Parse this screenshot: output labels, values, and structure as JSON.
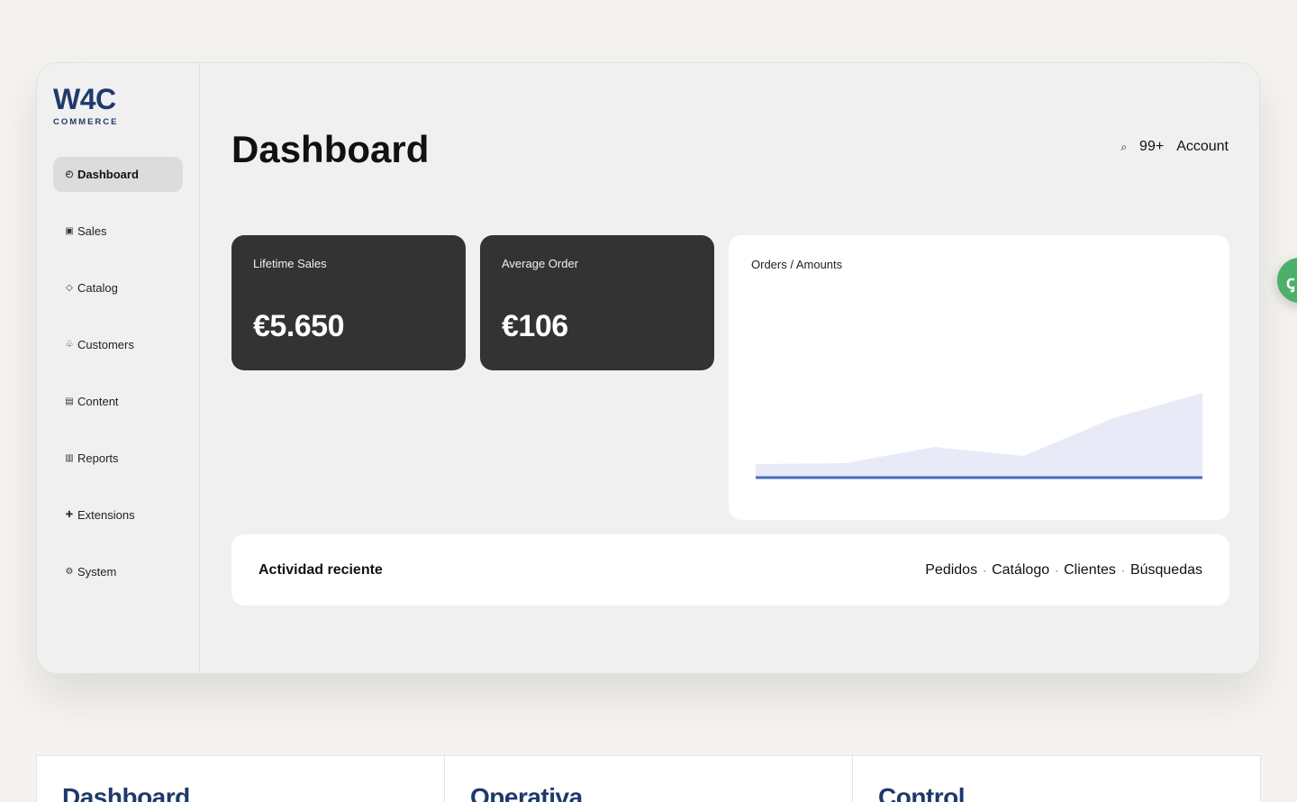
{
  "brand": {
    "name": "W4C",
    "tagline": "COMMERCE"
  },
  "sidebar": {
    "items": [
      {
        "icon": "◴",
        "icon_name": "dashboard-icon",
        "label": "Dashboard",
        "active": true
      },
      {
        "icon": "▣",
        "icon_name": "sales-icon",
        "label": "Sales"
      },
      {
        "icon": "◇",
        "icon_name": "catalog-icon",
        "label": "Catalog"
      },
      {
        "icon": "♧",
        "icon_name": "customers-icon",
        "label": "Customers"
      },
      {
        "icon": "▤",
        "icon_name": "content-icon",
        "label": "Content"
      },
      {
        "icon": "▥",
        "icon_name": "reports-icon",
        "label": "Reports"
      },
      {
        "icon": "✚",
        "icon_name": "extensions-icon",
        "label": "Extensions"
      },
      {
        "icon": "⚙",
        "icon_name": "system-icon",
        "label": "System"
      }
    ]
  },
  "header": {
    "title": "Dashboard",
    "search_icon": "⌕",
    "notifications": "99+",
    "account": "Account"
  },
  "cards": [
    {
      "label": "Lifetime Sales",
      "value": "€5.650"
    },
    {
      "label": "Average Order",
      "value": "€106"
    }
  ],
  "chart": {
    "title": "Orders / Amounts",
    "colors": {
      "area": "#e8eaf8",
      "line": "#4a6bc4"
    }
  },
  "chart_data": {
    "type": "area",
    "title": "Orders / Amounts",
    "x": [
      0,
      1,
      2,
      3,
      4,
      5,
      6
    ],
    "series": [
      {
        "values": [
          15,
          16,
          34,
          24,
          66,
          94
        ]
      },
      {
        "values": [
          0,
          0,
          0,
          0,
          0,
          0
        ]
      }
    ],
    "ylim": [
      0,
      100
    ],
    "grid": false
  },
  "activity": {
    "title": "Actividad reciente",
    "links": [
      "Pedidos",
      "Catálogo",
      "Clientes",
      "Búsquedas"
    ],
    "separator": "·"
  },
  "fab": {
    "icon": "ꞔ",
    "icon_name": "chat-icon"
  },
  "bottom_panels": [
    "Dashboard",
    "Operativa",
    "Control"
  ]
}
